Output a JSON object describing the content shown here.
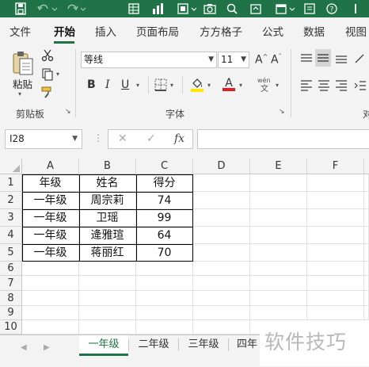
{
  "colors": {
    "accent": "#1f7346",
    "font_color": "#e02020",
    "highlight": "#ffe600"
  },
  "quick_access": {
    "icons": [
      "save-icon",
      "undo-icon",
      "redo-icon",
      "table-icon",
      "chart-icon",
      "format-icon",
      "camera-icon",
      "search-icon",
      "share-icon",
      "calendar-icon",
      "help-icon"
    ]
  },
  "menu": {
    "items": [
      "文件",
      "开始",
      "插入",
      "页面布局",
      "方方格子",
      "公式",
      "数据",
      "视图"
    ],
    "active": "开始"
  },
  "ribbon": {
    "clipboard": {
      "paste_label": "粘贴",
      "group_label": "剪贴板"
    },
    "font": {
      "font_name": "等线",
      "font_size": "11",
      "bold": "B",
      "italic": "I",
      "underline": "U",
      "group_label": "字体",
      "font_color_glyph": "A",
      "pinyin_top": "wén",
      "pinyin_bottom": "文",
      "grow_label": "A^",
      "shrink_label": "A˅"
    },
    "align": {
      "group_label": "对"
    }
  },
  "formula_bar": {
    "name_box": "I28",
    "cancel": "✕",
    "confirm": "✓",
    "fx": "fx",
    "formula": ""
  },
  "sheet": {
    "columns": [
      "A",
      "B",
      "C",
      "D",
      "E",
      "F"
    ],
    "rows": [
      "1",
      "2",
      "3",
      "4",
      "5",
      "6",
      "7",
      "8",
      "9",
      "10"
    ],
    "data": [
      [
        "年级",
        "姓名",
        "得分"
      ],
      [
        "一年级",
        "周宗莉",
        "74"
      ],
      [
        "一年级",
        "卫瑶",
        "99"
      ],
      [
        "一年级",
        "逄雅瑄",
        "64"
      ],
      [
        "一年级",
        "蒋丽红",
        "70"
      ]
    ]
  },
  "tabs": {
    "items": [
      "一年级",
      "二年级",
      "三年级",
      "四年"
    ],
    "active": "一年级"
  },
  "watermark": "软件技巧"
}
